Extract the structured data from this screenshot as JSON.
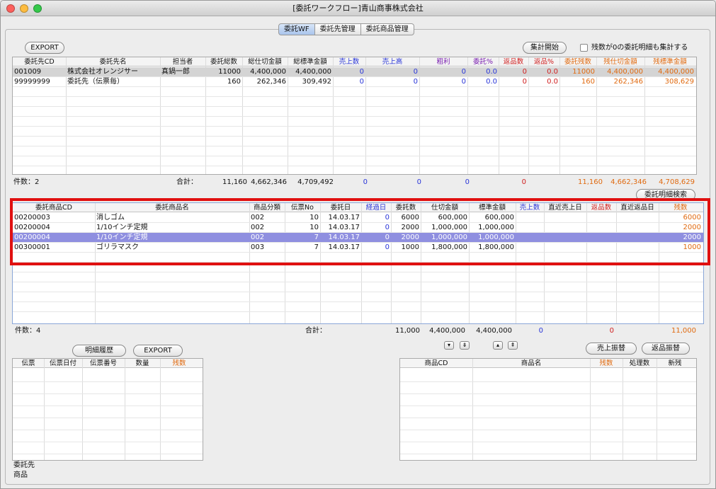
{
  "window": {
    "title": "[委託ワークフロー]青山商事株式会社"
  },
  "tabs": [
    {
      "label": "委託WF",
      "active": true
    },
    {
      "label": "委託先管理",
      "active": false
    },
    {
      "label": "委託商品管理",
      "active": false
    }
  ],
  "top": {
    "export_label": "EXPORT",
    "aggregate_label": "集計開始",
    "zero_checkbox_label": "残数が0の委託明細も集計する",
    "columns": [
      "委託先CD",
      "委託先名",
      "担当者",
      "委託総数",
      "総仕切金額",
      "総標準金額",
      "売上数",
      "売上高",
      "粗利",
      "委託%",
      "返品数",
      "返品%",
      "委託残数",
      "残仕切金額",
      "残標準金額"
    ],
    "rows": [
      [
        "001009",
        "株式会社オレンジサー",
        "真鍋一郎",
        "11000",
        "4,400,000",
        "4,400,000",
        "0",
        "0",
        "0",
        "0.0",
        "0",
        "0.0",
        "11000",
        "4,400,000",
        "4,400,000"
      ],
      [
        "99999999",
        "委託先（伝票毎）",
        "",
        "160",
        "262,346",
        "309,492",
        "0",
        "0",
        "0",
        "0.0",
        "0",
        "0.0",
        "160",
        "262,346",
        "308,629"
      ]
    ],
    "count_label": "件数：2",
    "total_label": "合計：",
    "totals": [
      "11,160",
      "4,662,346",
      "4,709,492",
      "0",
      "0",
      "0",
      "0",
      "11,160",
      "4,662,346",
      "4,708,629"
    ]
  },
  "middle": {
    "search_label": "委託明細検索",
    "columns": [
      "委託商品CD",
      "委託商品名",
      "商品分類",
      "伝票No",
      "委託日",
      "経過日",
      "委託数",
      "仕切金額",
      "標準金額",
      "売上数",
      "直近売上日",
      "返品数",
      "直近返品日",
      "残数"
    ],
    "rows": [
      [
        "00200003",
        "消しゴム",
        "002",
        "10",
        "14.03.17",
        "0",
        "6000",
        "600,000",
        "600,000",
        "",
        "",
        "",
        "",
        "6000"
      ],
      [
        "00200004",
        "1/10インチ定規",
        "002",
        "10",
        "14.03.17",
        "0",
        "2000",
        "1,000,000",
        "1,000,000",
        "",
        "",
        "",
        "",
        "2000"
      ],
      [
        "00200004",
        "1/10インチ定規",
        "002",
        "7",
        "14.03.17",
        "0",
        "2000",
        "1,000,000",
        "1,000,000",
        "",
        "",
        "",
        "",
        "2000"
      ],
      [
        "00300001",
        "ゴリラマスク",
        "003",
        "7",
        "14.03.17",
        "0",
        "1000",
        "1,800,000",
        "1,800,000",
        "",
        "",
        "",
        "",
        "1000"
      ]
    ],
    "count_label": "件数：4",
    "total_label": "合計：",
    "totals": [
      "11,000",
      "4,400,000",
      "4,400,000",
      "0",
      "0",
      "11,000"
    ]
  },
  "bottom_left": {
    "history_label": "明細履歴",
    "export_label": "EXPORT",
    "columns": [
      "伝票",
      "伝票日付",
      "伝票番号",
      "数量",
      "残数"
    ],
    "label_client": "委託先",
    "label_product": "商品"
  },
  "bottom_right": {
    "sales_transfer_label": "売上振替",
    "return_transfer_label": "返品振替",
    "columns": [
      "商品CD",
      "商品名",
      "残数",
      "処理数",
      "新残"
    ]
  },
  "colors": {
    "highlight": "#e01010",
    "selected_row": "#8f8fe0",
    "blue_text": "#2a36d8",
    "orange_text": "#e06a10"
  }
}
